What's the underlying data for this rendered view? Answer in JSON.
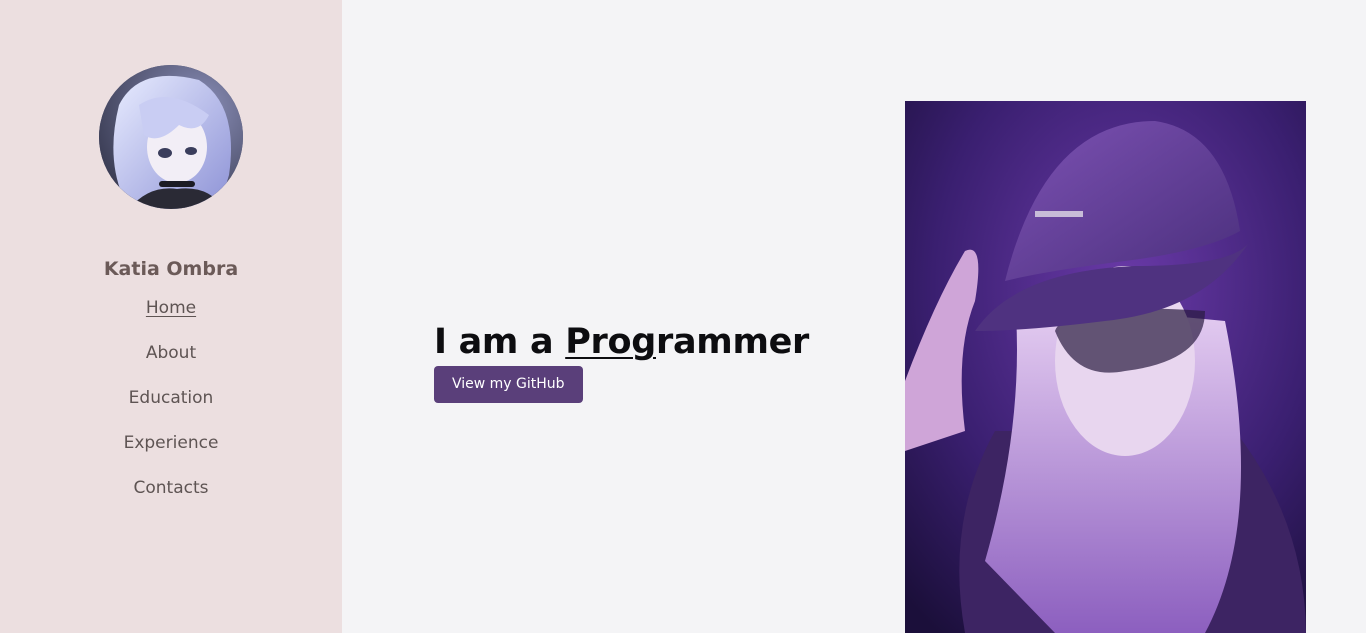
{
  "sidebar": {
    "avatar_icon": "anime-avatar-portrait",
    "name": "Katia Ombra",
    "nav": [
      {
        "label": "Home",
        "active": true
      },
      {
        "label": "About",
        "active": false
      },
      {
        "label": "Education",
        "active": false
      },
      {
        "label": "Experience",
        "active": false
      },
      {
        "label": "Contacts",
        "active": false
      }
    ]
  },
  "hero": {
    "title_prefix": "I am a ",
    "title_typed": "Prog",
    "title_rest": "rammer",
    "button_label": "View my GitHub",
    "portrait_icon": "girl-in-purple-cap-portrait"
  },
  "colors": {
    "sidebar_bg": "#ecdfe0",
    "main_bg": "#f4f4f6",
    "button_bg": "#5a3f7a",
    "name_color": "#6b5a58"
  }
}
